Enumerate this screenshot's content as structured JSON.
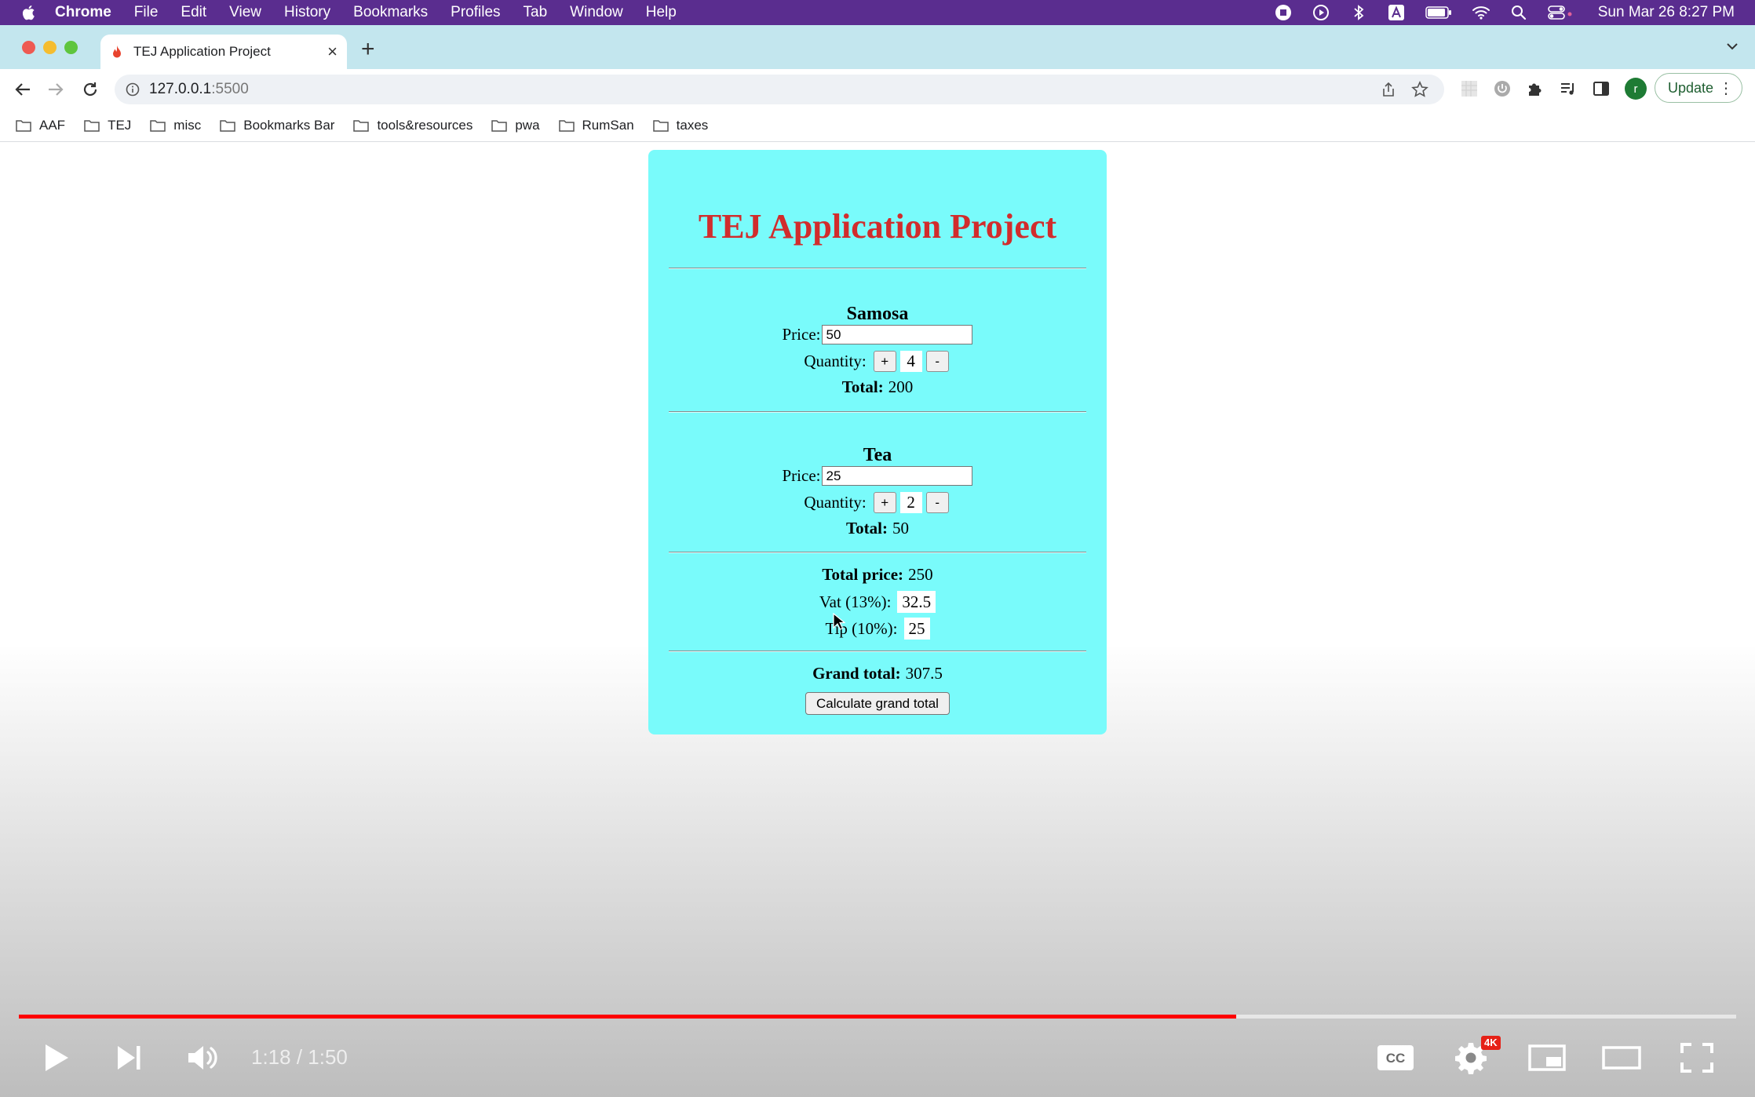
{
  "menubar": {
    "app_name": "Chrome",
    "items": [
      "File",
      "Edit",
      "View",
      "History",
      "Bookmarks",
      "Profiles",
      "Tab",
      "Window",
      "Help"
    ],
    "clock": "Sun Mar 26  8:27 PM"
  },
  "browser": {
    "tab_title": "TEJ Application Project",
    "url_host": "127.0.0.1",
    "url_port": ":5500",
    "profile_initial": "r",
    "update_label": "Update"
  },
  "bookmarks": [
    "AAF",
    "TEJ",
    "misc",
    "Bookmarks Bar",
    "tools&resources",
    "pwa",
    "RumSan",
    "taxes"
  ],
  "app": {
    "title": "TEJ Application Project",
    "items": [
      {
        "name": "Samosa",
        "price_label": "Price:",
        "price": "50",
        "quantity_label": "Quantity:",
        "plus": "+",
        "quantity": "4",
        "minus": "-",
        "total_label": "Total:",
        "total": "200"
      },
      {
        "name": "Tea",
        "price_label": "Price:",
        "price": "25",
        "quantity_label": "Quantity:",
        "plus": "+",
        "quantity": "2",
        "minus": "-",
        "total_label": "Total:",
        "total": "50"
      }
    ],
    "total_price_label": "Total price:",
    "total_price": "250",
    "vat_label": "Vat (13%):",
    "vat": "32.5",
    "tip_label": "Tip (10%):",
    "tip": "25",
    "grand_total_label": "Grand total:",
    "grand_total": "307.5",
    "calc_button": "Calculate grand total"
  },
  "player": {
    "time": "1:18 / 1:50",
    "progress_fraction": 0.709,
    "settings_badge": "4K",
    "accent": "#ff0000"
  },
  "colors": {
    "card_background": "#79fbfb",
    "title_color": "#d12c2c",
    "menubar": "#5a2d8f"
  }
}
